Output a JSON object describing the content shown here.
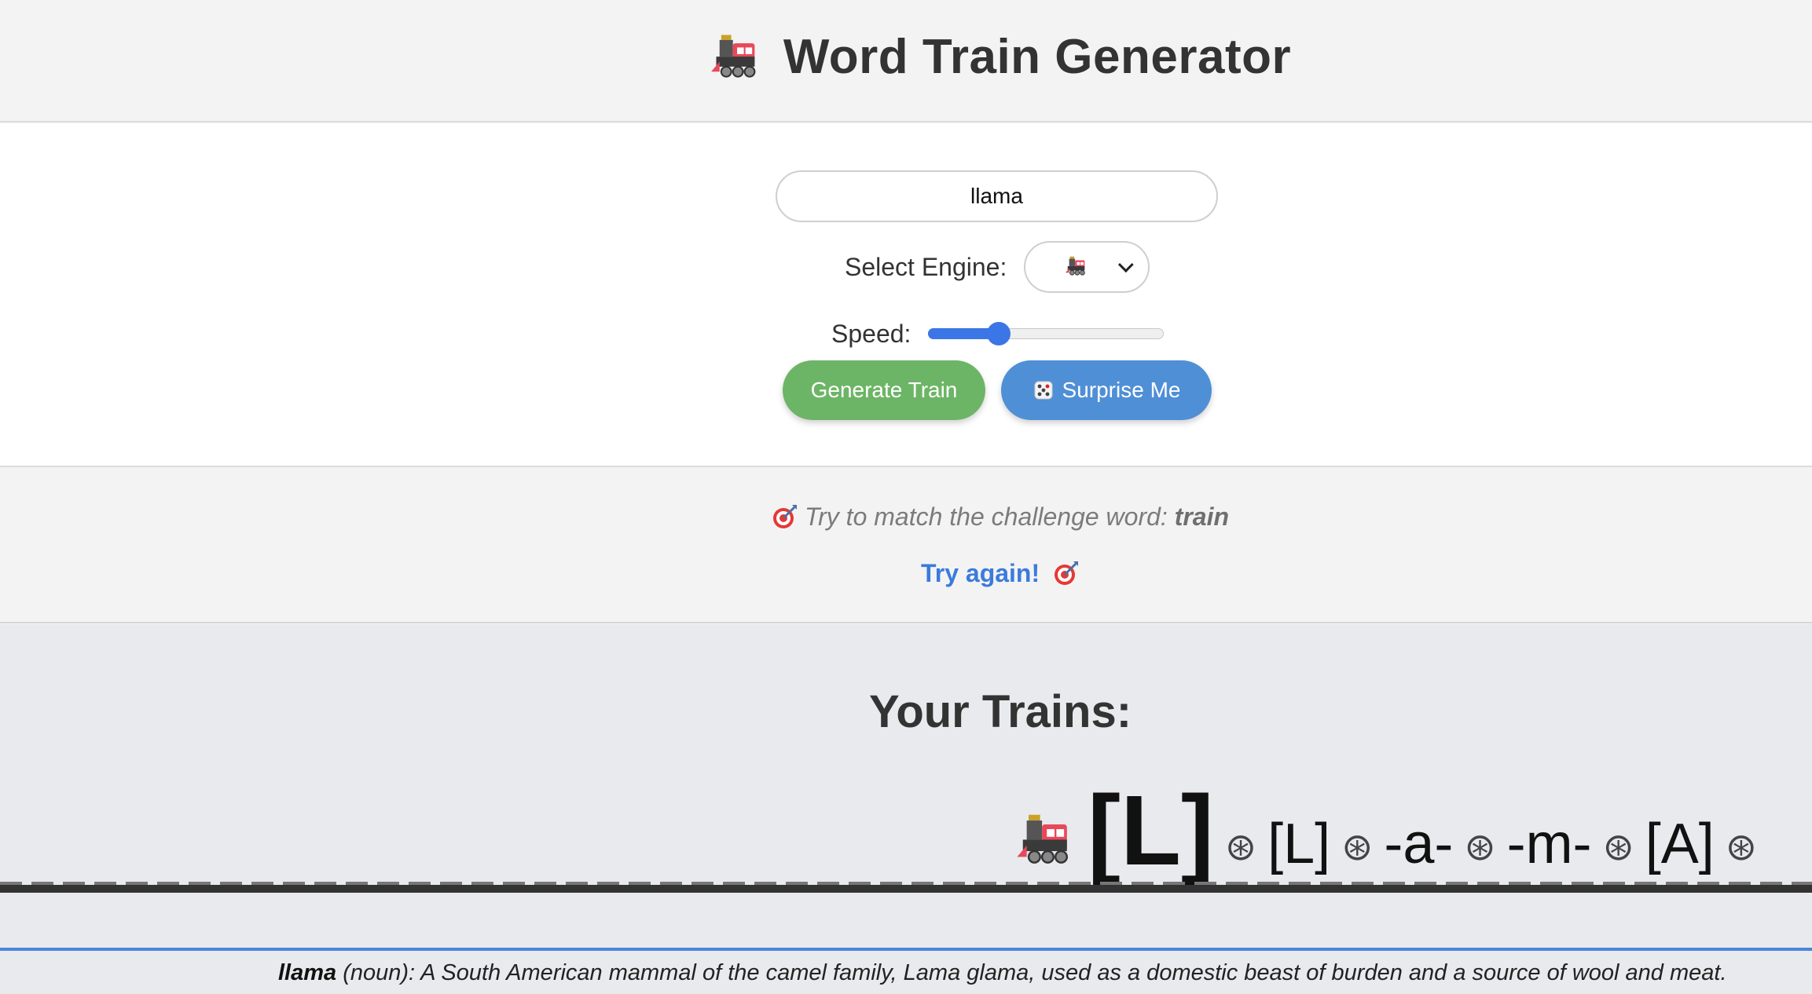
{
  "header": {
    "title": "Word Train Generator",
    "icon": "locomotive-icon"
  },
  "form": {
    "word_value": "llama",
    "engine_label": "Select Engine:",
    "engine_selected": "🚂",
    "speed_label": "Speed:",
    "speed_fraction": 0.3,
    "generate_label": "Generate Train",
    "surprise_label": "Surprise Me",
    "surprise_icon": "dice-icon"
  },
  "challenge": {
    "prompt": "Try to match the challenge word:",
    "word": "train",
    "feedback": "Try again!",
    "icon": "target-icon"
  },
  "trains": {
    "heading": "Your Trains:",
    "engine_icon": "locomotive-icon",
    "engine_letter": "[L]",
    "cars": [
      "[L]",
      "-a-",
      "-m-",
      "[A]"
    ],
    "wheel_glyph": "⊛"
  },
  "definition": {
    "word": "llama",
    "text": " (noun): A South American mammal of the camel family, Lama glama, used as a domestic beast of burden and a source of wool and meat."
  },
  "colors": {
    "accent_blue": "#3b76e6",
    "generate_green": "#6db566",
    "surprise_blue": "#4f8fd6",
    "feedback_blue": "#3b7bdb"
  }
}
